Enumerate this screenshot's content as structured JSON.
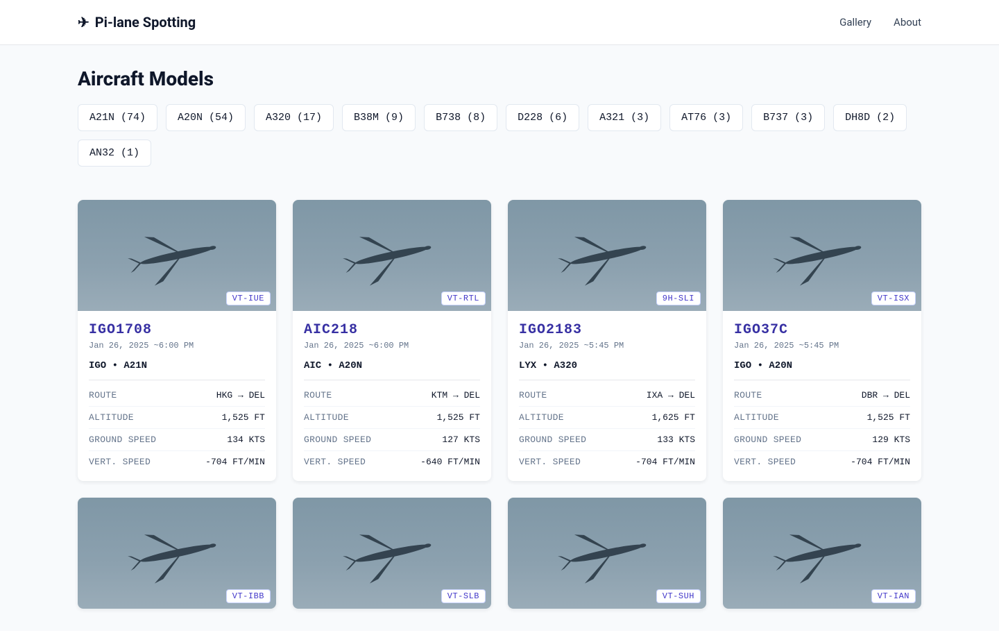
{
  "header": {
    "brand": "Pi-lane Spotting",
    "nav": {
      "gallery": "Gallery",
      "about": "About"
    }
  },
  "page": {
    "title": "Aircraft Models"
  },
  "filters": [
    {
      "label": "A21N (74)"
    },
    {
      "label": "A20N (54)"
    },
    {
      "label": "A320 (17)"
    },
    {
      "label": "B38M (9)"
    },
    {
      "label": "B738 (8)"
    },
    {
      "label": "D228 (6)"
    },
    {
      "label": "A321 (3)"
    },
    {
      "label": "AT76 (3)"
    },
    {
      "label": "B737 (3)"
    },
    {
      "label": "DH8D (2)"
    },
    {
      "label": "AN32 (1)"
    }
  ],
  "stat_labels": {
    "route": "ROUTE",
    "altitude": "ALTITUDE",
    "ground_speed": "GROUND SPEED",
    "vert_speed": "VERT. SPEED"
  },
  "cards": [
    {
      "reg": "VT-IUE",
      "callsign": "IGO1708",
      "time": "Jan 26, 2025 ~6:00 PM",
      "meta": "IGO • A21N",
      "route": "HKG → DEL",
      "altitude": "1,525 FT",
      "ground_speed": "134 KTS",
      "vert_speed": "-704 FT/MIN"
    },
    {
      "reg": "VT-RTL",
      "callsign": "AIC218",
      "time": "Jan 26, 2025 ~6:00 PM",
      "meta": "AIC • A20N",
      "route": "KTM → DEL",
      "altitude": "1,525 FT",
      "ground_speed": "127 KTS",
      "vert_speed": "-640 FT/MIN"
    },
    {
      "reg": "9H-SLI",
      "callsign": "IGO2183",
      "time": "Jan 26, 2025 ~5:45 PM",
      "meta": "LYX • A320",
      "route": "IXA → DEL",
      "altitude": "1,625 FT",
      "ground_speed": "133 KTS",
      "vert_speed": "-704 FT/MIN"
    },
    {
      "reg": "VT-ISX",
      "callsign": "IGO37C",
      "time": "Jan 26, 2025 ~5:45 PM",
      "meta": "IGO • A20N",
      "route": "DBR → DEL",
      "altitude": "1,525 FT",
      "ground_speed": "129 KTS",
      "vert_speed": "-704 FT/MIN"
    },
    {
      "reg": "VT-IBB"
    },
    {
      "reg": "VT-SLB"
    },
    {
      "reg": "VT-SUH"
    },
    {
      "reg": "VT-IAN"
    }
  ]
}
